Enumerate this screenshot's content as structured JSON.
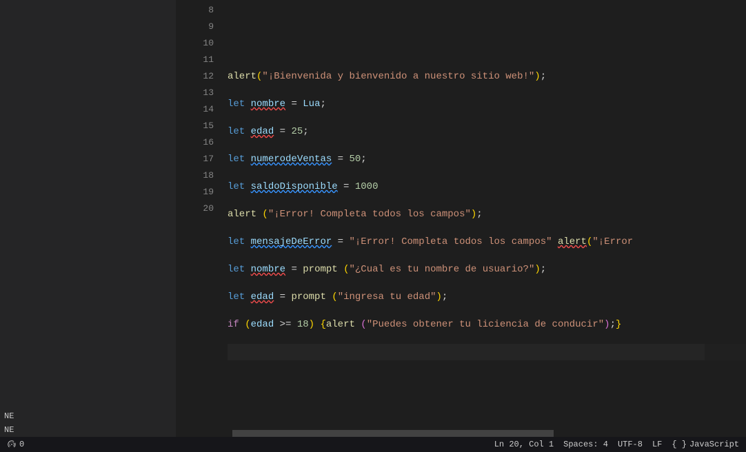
{
  "outline": {
    "item1": "NE",
    "item2": "NE"
  },
  "gutter": [
    "8",
    "9",
    "10",
    "11",
    "12",
    "13",
    "14",
    "15",
    "16",
    "17",
    "18",
    "19",
    "20"
  ],
  "code": {
    "l10": {
      "fn": "alert",
      "p1": "(",
      "s": "\"¡Bienvenida y bienvenido a nuestro sitio web!\"",
      "p2": ")",
      "semi": ";"
    },
    "l11": {
      "kw": "let",
      "var": "nombre",
      "eq": " = ",
      "val": "Lua",
      "semi": ";"
    },
    "l12": {
      "kw": "let",
      "var": "edad",
      "eq": " = ",
      "num": "25",
      "semi": ";"
    },
    "l13": {
      "kw": "let",
      "var": "numerodeVentas",
      "eq": " = ",
      "num": "50",
      "semi": ";"
    },
    "l14": {
      "kw": "let",
      "var": "saldoDisponible",
      "eq": " = ",
      "num": "1000"
    },
    "l15": {
      "fn": "alert",
      "sp": " ",
      "p1": "(",
      "s": "\"¡Error! Completa todos los campos\"",
      "p2": ")",
      "semi": ";"
    },
    "l16": {
      "kw": "let",
      "var": "mensajeDeError",
      "eq": " = ",
      "s": "\"¡Error! Completa todos los campos\"",
      "sp": " ",
      "fn": "alert",
      "p1": "(",
      "s2": "\"¡Error"
    },
    "l17": {
      "kw": "let",
      "var": "nombre",
      "eq": " = ",
      "fn": "prompt",
      "sp": " ",
      "p1": "(",
      "s": "\"¿Cual es tu nombre de usuario?\"",
      "p2": ")",
      "semi": ";"
    },
    "l18": {
      "kw": "let",
      "var": "edad",
      "eq": " = ",
      "fn": "prompt",
      "sp": " ",
      "p1": "(",
      "s": "\"ingresa tu edad\"",
      "p2": ")",
      "semi": ";"
    },
    "l19": {
      "ctrl": "if",
      "sp": " ",
      "p1": "(",
      "var": "edad",
      "op": " >= ",
      "num": "18",
      "p2": ")",
      "sp2": " ",
      "b1": "{",
      "fn": "alert",
      "sp3": " ",
      "p3": "(",
      "s": "\"Puedes obtener tu liciencia de conducir\"",
      "p4": ")",
      "semi": ";",
      "b2": "}"
    }
  },
  "status": {
    "errors": "0",
    "lncol": "Ln 20, Col 1",
    "spaces": "Spaces: 4",
    "enc": "UTF-8",
    "eol": "LF",
    "lang": "JavaScript"
  }
}
